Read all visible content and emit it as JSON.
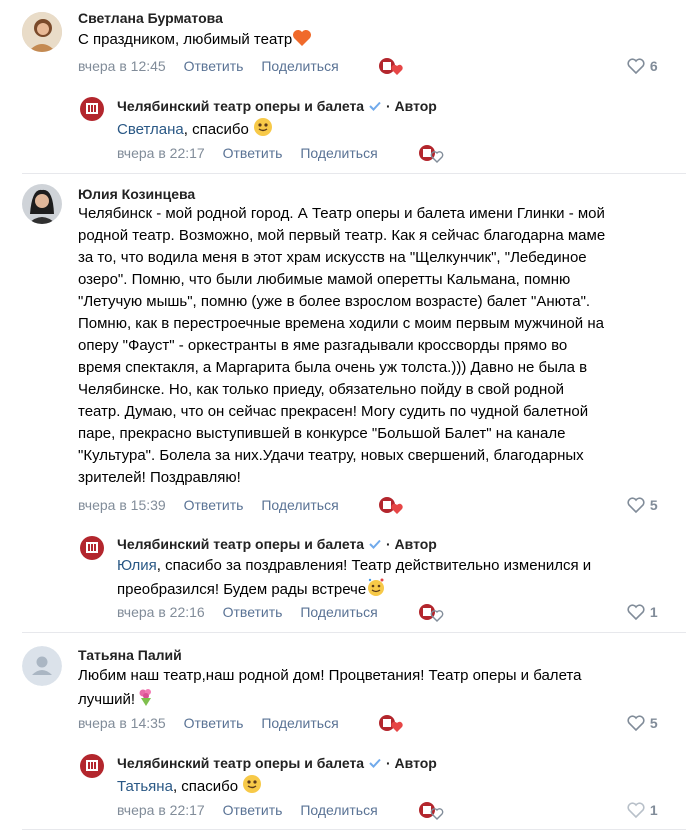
{
  "comments": [
    {
      "author": "Светлана Бурматова",
      "text": "С праздником, любимый театр",
      "time": "вчера в 12:45",
      "reply_label": "Ответить",
      "share_label": "Поделиться",
      "likes": "6",
      "reply": {
        "author": "Челябинский театр оперы и балета",
        "author_tag": "· Автор",
        "mention": "Светлана",
        "text": ", спасибо",
        "time": "вчера в 22:17",
        "reply_label": "Ответить",
        "share_label": "Поделиться",
        "likes": ""
      }
    },
    {
      "author": "Юлия Козинцева",
      "lines": [
        "Челябинск - мой родной город. А Театр оперы и балета имени Глинки - мой",
        "родной театр. Возможно, мой первый театр. Как я сейчас благодарна маме",
        "за то, что водила меня в этот храм искусств на \"Щелкунчик\", \"Лебединое",
        "озеро\". Помню, что были любимые мамой оперетты Кальмана, помню",
        "\"Летучую мышь\", помню (уже в более взрослом возрасте) балет \"Анюта\".",
        "Помню, как в перестроечные времена ходили с моим первым мужчиной на",
        "оперу \"Фауст\" - оркестранты в яме разгадывали кроссворды прямо во",
        "время спектакля, а Маргарита была очень уж толста.))) Давно не была в",
        "Челябинске. Но, как только приеду, обязательно пойду в свой родной",
        "театр. Думаю, что он сейчас прекрасен! Могу судить по чудной балетной",
        "паре, прекрасно выступившей в конкурсе \"Большой Балет\" на канале",
        "\"Культура\". Болела за них.Удачи театру, новых свершений, благодарных",
        "зрителей! Поздравляю!"
      ],
      "time": "вчера в 15:39",
      "reply_label": "Ответить",
      "share_label": "Поделиться",
      "likes": "5",
      "reply": {
        "author": "Челябинский театр оперы и балета",
        "author_tag": "· Автор",
        "mention": "Юлия",
        "line1": ", спасибо за поздравления! Театр действительно изменился и",
        "line2": "преобразился! Будем рады встрече",
        "time": "вчера в 22:16",
        "reply_label": "Ответить",
        "share_label": "Поделиться",
        "likes": "1"
      }
    },
    {
      "author": "Татьяна Палий",
      "line1": "Любим наш театр,наш родной дом! Процветания! Театр оперы и балета",
      "line2": "лучший!",
      "time": "вчера в 14:35",
      "reply_label": "Ответить",
      "share_label": "Поделиться",
      "likes": "5",
      "reply": {
        "author": "Челябинский театр оперы и балета",
        "author_tag": "· Автор",
        "mention": "Татьяна",
        "text": ", спасибо",
        "time": "вчера в 22:17",
        "reply_label": "Ответить",
        "share_label": "Поделиться",
        "likes": "1"
      }
    }
  ],
  "colors": {
    "accent": "#2a5885",
    "meta": "#818c99",
    "action": "#5a7395",
    "verified": "#71aaeb",
    "heart": "#e64646",
    "logo": "#b3262d"
  },
  "icons": [
    "heart-icon",
    "verified-icon",
    "theatre-logo-icon",
    "default-avatar-icon"
  ]
}
